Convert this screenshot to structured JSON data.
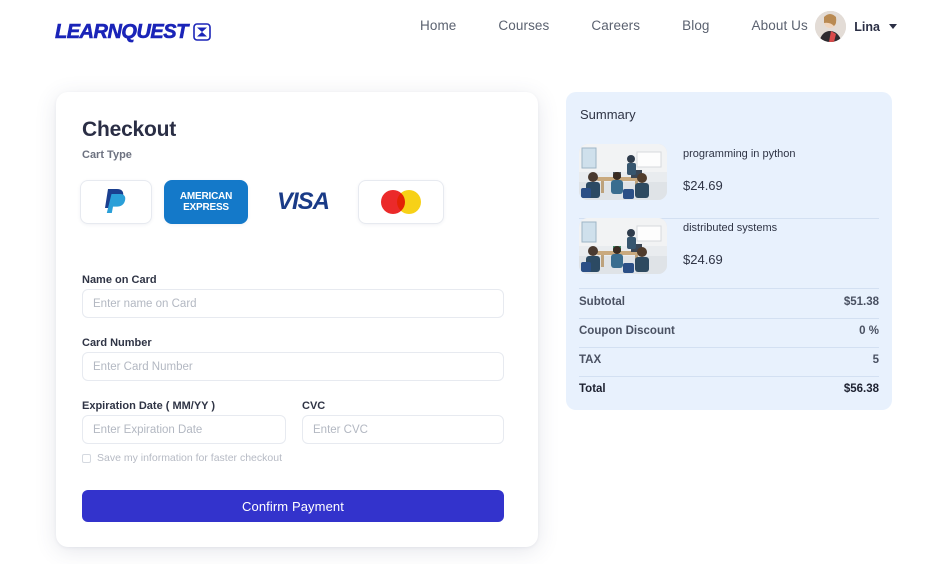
{
  "header": {
    "logo_text": "LEARNQUEST",
    "logo_icon": "graduation-cap-icon",
    "nav": [
      {
        "label": "Home"
      },
      {
        "label": "Courses"
      },
      {
        "label": "Careers"
      },
      {
        "label": "Blog"
      },
      {
        "label": "About Us"
      }
    ],
    "user": {
      "name": "Lina",
      "avatar_icon": "user-avatar-photo",
      "chevron_icon": "chevron-down-icon"
    }
  },
  "checkout": {
    "title": "Checkout",
    "cart_type_label": "Cart Type",
    "payment_methods": [
      {
        "name": "paypal",
        "label": "PayPal",
        "selected": false
      },
      {
        "name": "amex",
        "label": "AMERICAN EXPRESS",
        "line1": "AMERICAN",
        "line2": "EXPRESS",
        "selected": true
      },
      {
        "name": "visa",
        "label": "VISA",
        "selected": false
      },
      {
        "name": "mastercard",
        "label": "Mastercard",
        "selected": false
      }
    ],
    "fields": {
      "name_label": "Name on Card",
      "name_placeholder": "Enter name on Card",
      "name_value": "",
      "card_label": "Card Number",
      "card_placeholder": "Enter Card Number",
      "card_value": "",
      "exp_label": "Expiration Date ( MM/YY )",
      "exp_placeholder": "Enter Expiration Date",
      "exp_value": "",
      "cvc_label": "CVC",
      "cvc_placeholder": "Enter CVC",
      "cvc_value": ""
    },
    "save_checkbox": {
      "label": "Save my information for faster checkout",
      "checked": false
    },
    "submit_label": "Confirm Payment"
  },
  "summary": {
    "title": "Summary",
    "items": [
      {
        "name": "programming in python",
        "price": "$24.69",
        "thumb": "classroom-photo"
      },
      {
        "name": "distributed systems",
        "price": "$24.69",
        "thumb": "classroom-photo"
      }
    ],
    "totals": [
      {
        "label": "Subtotal",
        "value": "$51.38"
      },
      {
        "label": "Coupon Discount",
        "value": "0 %"
      },
      {
        "label": "TAX",
        "value": "5"
      }
    ],
    "grand_total": {
      "label": "Total",
      "value": "$56.38"
    }
  },
  "colors": {
    "brand_blue": "#1a24b8",
    "button_blue": "#3333cc",
    "amex_blue": "#1479c9",
    "summary_bg": "#e8f1fd",
    "heading": "#2a2e45"
  }
}
